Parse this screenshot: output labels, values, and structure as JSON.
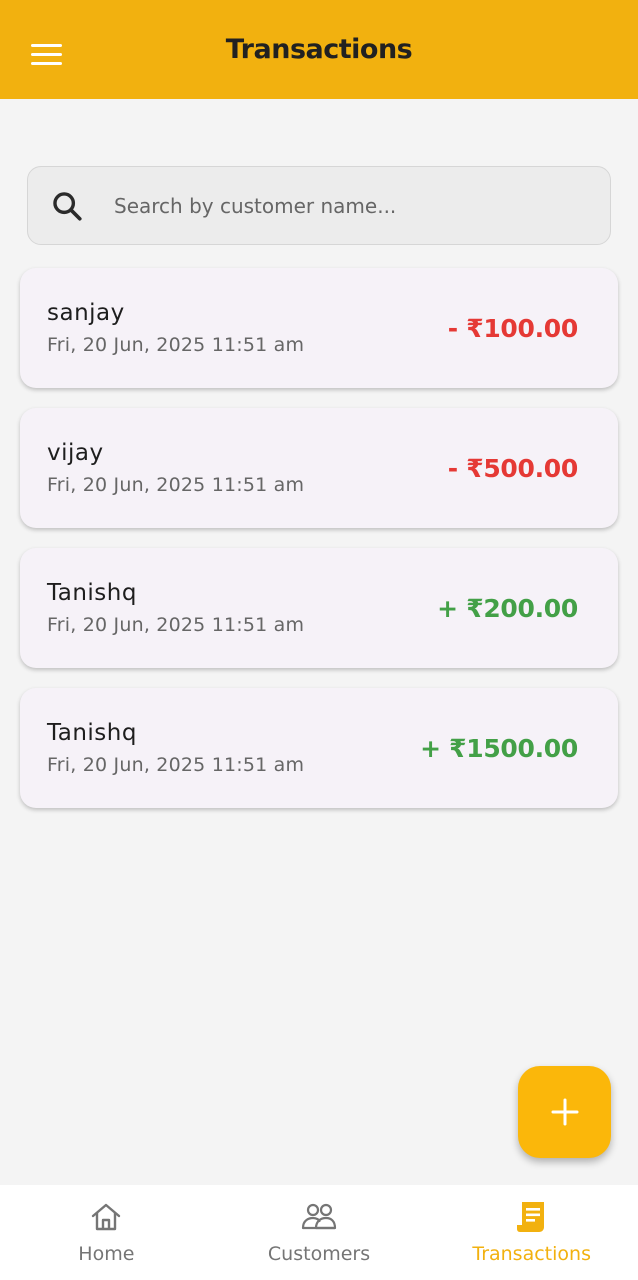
{
  "header": {
    "title": "Transactions"
  },
  "search": {
    "placeholder": "Search by customer name..."
  },
  "transactions": [
    {
      "name": "sanjay",
      "date": "Fri, 20 Jun, 2025 11:51 am",
      "amount": "- ₹100.00",
      "type": "debit"
    },
    {
      "name": "vijay",
      "date": "Fri, 20 Jun, 2025 11:51 am",
      "amount": "- ₹500.00",
      "type": "debit"
    },
    {
      "name": "Tanishq",
      "date": "Fri, 20 Jun, 2025 11:51 am",
      "amount": "+ ₹200.00",
      "type": "credit"
    },
    {
      "name": "Tanishq",
      "date": "Fri, 20 Jun, 2025 11:51 am",
      "amount": "+ ₹1500.00",
      "type": "credit"
    }
  ],
  "bottom_nav": {
    "items": [
      {
        "label": "Home",
        "icon": "home-icon",
        "active": false
      },
      {
        "label": "Customers",
        "icon": "customers-icon",
        "active": false
      },
      {
        "label": "Transactions",
        "icon": "transactions-icon",
        "active": true
      }
    ]
  },
  "fab": {
    "icon": "plus-icon"
  },
  "colors": {
    "brand": "#f2b10f",
    "debit": "#e53935",
    "credit": "#43a047",
    "fab": "#fbb70a"
  }
}
